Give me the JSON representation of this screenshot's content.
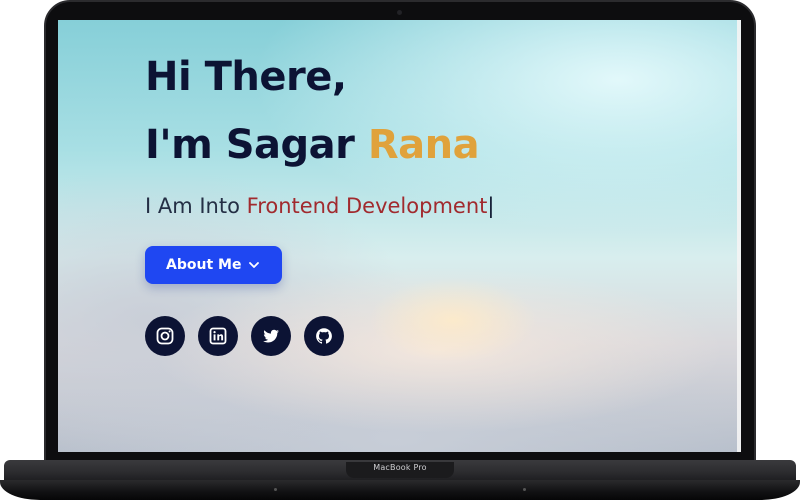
{
  "hero": {
    "greeting": "Hi There,",
    "intro_prefix": "I'm Sagar ",
    "intro_accent": "Rana",
    "typing_prefix": "I Am Into ",
    "typing_text": "Frontend Development",
    "cursor": "|"
  },
  "buttons": {
    "about_label": "About Me"
  },
  "social": [
    {
      "name": "instagram-icon"
    },
    {
      "name": "linkedin-icon"
    },
    {
      "name": "twitter-icon"
    },
    {
      "name": "github-icon"
    }
  ],
  "device": {
    "label": "MacBook Pro"
  },
  "colors": {
    "heading": "#0c1334",
    "accent_name": "#e0a23b",
    "typed_text": "#a12a2e",
    "button": "#1f47f2",
    "social_bg": "#0c1334"
  }
}
